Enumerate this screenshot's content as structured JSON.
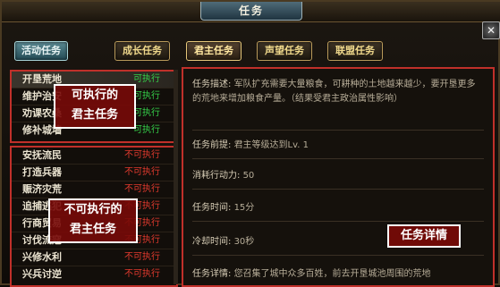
{
  "window": {
    "title": "任务",
    "close_icon": "close-icon"
  },
  "tabs": [
    {
      "label": "活动任务"
    },
    {
      "label": "成长任务"
    },
    {
      "label": "君主任务"
    },
    {
      "label": "声望任务"
    },
    {
      "label": "联盟任务"
    }
  ],
  "executable_tasks": {
    "overlay_label": "可执行的\n君主任务",
    "rows": [
      {
        "name": "开垦荒地",
        "status": "可执行"
      },
      {
        "name": "维护治安",
        "status": "可执行"
      },
      {
        "name": "劝课农桑",
        "status": "可执行"
      },
      {
        "name": "修补城墙",
        "status": "可执行"
      }
    ]
  },
  "blocked_tasks": {
    "overlay_label": "不可执行的\n君主任务",
    "rows": [
      {
        "name": "安抚流民",
        "status": "不可执行"
      },
      {
        "name": "打造兵器",
        "status": "不可执行"
      },
      {
        "name": "赈济灾荒",
        "status": "不可执行"
      },
      {
        "name": "追捕逃犯",
        "status": "不可执行"
      },
      {
        "name": "行商贸易",
        "status": "不可执行"
      },
      {
        "name": "讨伐流寇",
        "status": "不可执行"
      },
      {
        "name": "兴修水利",
        "status": "不可执行"
      },
      {
        "name": "兴兵讨逆",
        "status": "不可执行"
      }
    ]
  },
  "detail": {
    "tag_label": "任务详情",
    "description_label": "任务描述:",
    "description_value": "军队扩充需要大量粮食，可耕种的土地越来越少，要开垦更多的荒地来增加粮食产量。（结果受君主政治属性影响）",
    "prereq_label": "任务前提:",
    "prereq_value": "君主等级达到Lv. 1",
    "cost_label": "消耗行动力:",
    "cost_value": "50",
    "time_label": "任务时间:",
    "time_value": "15分",
    "cooldown_label": "冷却时间:",
    "cooldown_value": "30秒",
    "details_label": "任务详情:",
    "details_value": "您召集了城中众多百姓，前去开垦城池周围的荒地"
  }
}
